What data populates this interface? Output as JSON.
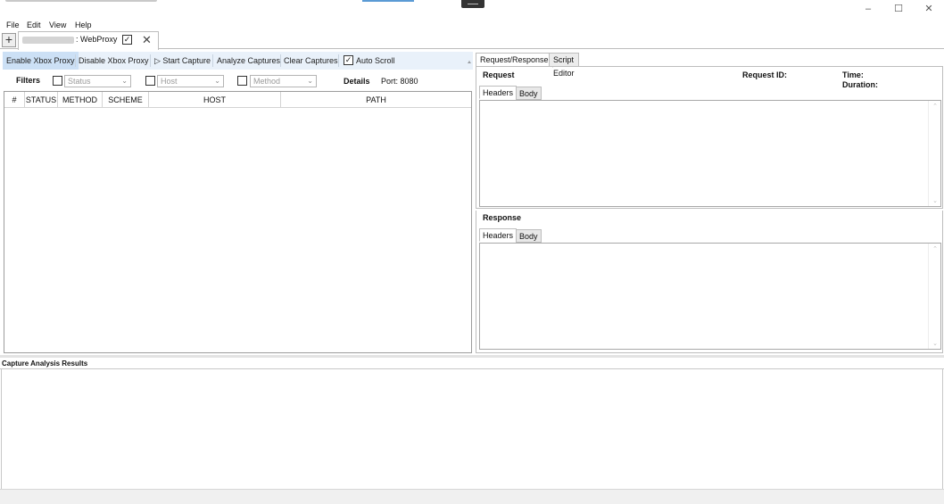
{
  "menu": {
    "items": [
      "File",
      "Edit",
      "View",
      "Help"
    ]
  },
  "window_controls": {
    "minimize": "–",
    "maximize": "☐",
    "close": "✕"
  },
  "tab": {
    "add_label": "+",
    "label": ": WebProxy",
    "checked": true,
    "close": "✕"
  },
  "toolbar": {
    "enable_proxy": "Enable Xbox Proxy",
    "disable_proxy": "Disable Xbox Proxy",
    "start_capture": "▷ Start Capture",
    "analyze": "Analyze Captures",
    "clear": "Clear Captures",
    "auto_scroll": "Auto Scroll",
    "auto_scroll_checked": true,
    "more_glyph": "⩡"
  },
  "filters": {
    "label": "Filters",
    "status_placeholder": "Status",
    "host_placeholder": "Host",
    "method_placeholder": "Method",
    "details_label": "Details",
    "port_label": "Port: 8080"
  },
  "grid": {
    "columns": [
      "#",
      "STATUS",
      "METHOD",
      "SCHEME",
      "HOST",
      "PATH"
    ],
    "rows": []
  },
  "right_panel": {
    "tabs": [
      "Request/Response",
      "Script Editor"
    ],
    "request": {
      "title": "Request",
      "id_label": "Request ID:",
      "time_label": "Time:",
      "duration_label": "Duration:",
      "subtabs": [
        "Headers",
        "Body"
      ]
    },
    "response": {
      "title": "Response",
      "subtabs": [
        "Headers",
        "Body"
      ]
    }
  },
  "analysis": {
    "title": "Capture Analysis Results"
  },
  "colors": {
    "toolbar_bg": "#e9f1fa",
    "active_button": "#cce0f5",
    "accent": "#5b9bd5"
  }
}
